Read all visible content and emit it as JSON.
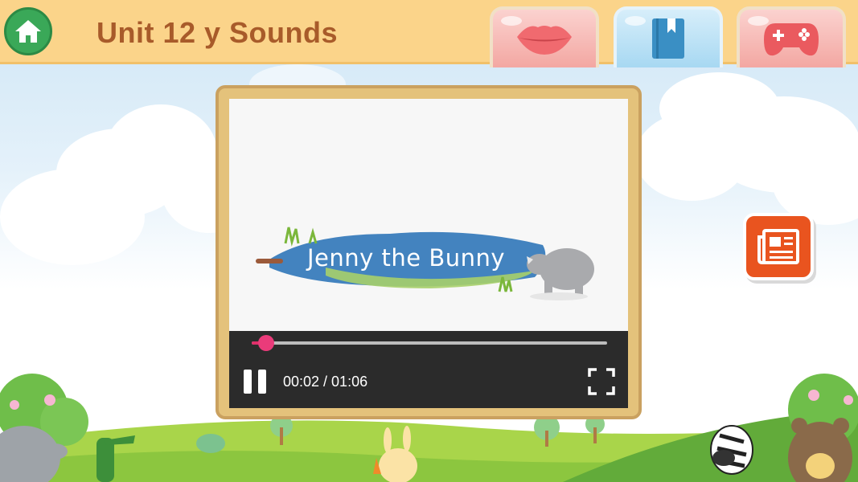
{
  "header": {
    "title": "Unit 12 y Sounds"
  },
  "nav": {
    "home_icon": "home-icon",
    "tabs": [
      {
        "icon": "lips-icon",
        "active": false
      },
      {
        "icon": "book-icon",
        "active": true
      },
      {
        "icon": "gamepad-icon",
        "active": false
      }
    ]
  },
  "video": {
    "title_text": "Jenny the Bunny",
    "current_time": "00:02",
    "duration": "01:06",
    "time_display": "00:02 / 01:06",
    "progress": 0.04,
    "state": "playing"
  },
  "side": {
    "article_icon": "newspaper-icon"
  },
  "colors": {
    "topbar": "#fbd48a",
    "title": "#a85b2a",
    "home": "#3aa858",
    "seek": "#ea3b7a",
    "article_button": "#e9541f"
  }
}
